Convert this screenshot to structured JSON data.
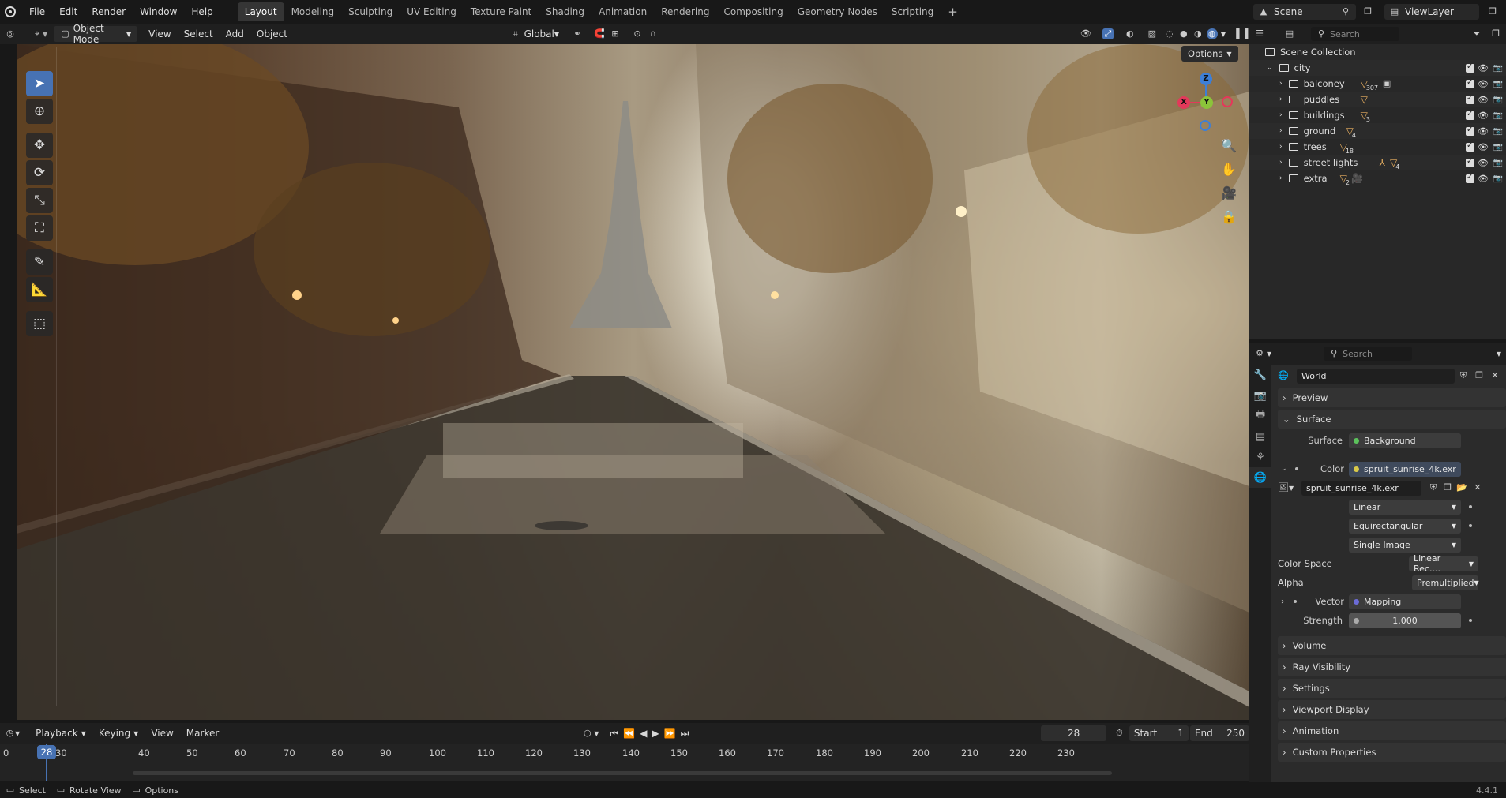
{
  "menubar": {
    "items": [
      "File",
      "Edit",
      "Render",
      "Window",
      "Help"
    ]
  },
  "workspaces": [
    "Layout",
    "Modeling",
    "Sculpting",
    "UV Editing",
    "Texture Paint",
    "Shading",
    "Animation",
    "Rendering",
    "Compositing",
    "Geometry Nodes",
    "Scripting"
  ],
  "active_workspace": "Layout",
  "scene": {
    "label": "Scene"
  },
  "view_layer": {
    "label": "ViewLayer"
  },
  "viewport_header": {
    "mode": "Object Mode",
    "menus": [
      "View",
      "Select",
      "Add",
      "Object"
    ],
    "orientation": "Global",
    "options": "Options"
  },
  "gizmo": {
    "x": "X",
    "y": "Y",
    "z": "Z"
  },
  "outliner": {
    "search_placeholder": "Search",
    "root": "Scene Collection",
    "collection": "city",
    "items": [
      {
        "name": "balconey",
        "count": "307"
      },
      {
        "name": "puddles",
        "count": ""
      },
      {
        "name": "buildings",
        "count": "3"
      },
      {
        "name": "ground",
        "count": "4"
      },
      {
        "name": "trees",
        "count": "18"
      },
      {
        "name": "street lights",
        "count": "4"
      },
      {
        "name": "extra",
        "count": "2"
      }
    ]
  },
  "properties": {
    "search_placeholder": "Search",
    "datablock": "World",
    "panels": {
      "preview": "Preview",
      "surface": "Surface",
      "volume": "Volume",
      "ray_visibility": "Ray Visibility",
      "settings": "Settings",
      "viewport_display": "Viewport Display",
      "animation": "Animation",
      "custom_properties": "Custom Properties"
    },
    "surface_label": "Surface",
    "surface_value": "Background",
    "color_label": "Color",
    "color_value": "spruit_sunrise_4k.exr",
    "image_name": "spruit_sunrise_4k.exr",
    "interpolation": "Linear",
    "projection": "Equirectangular",
    "source": "Single Image",
    "color_space_label": "Color Space",
    "color_space_value": "Linear Rec....",
    "alpha_label": "Alpha",
    "alpha_value": "Premultiplied",
    "vector_label": "Vector",
    "vector_value": "Mapping",
    "strength_label": "Strength",
    "strength_value": "1.000"
  },
  "timeline": {
    "menus": [
      "Playback",
      "Keying",
      "View",
      "Marker"
    ],
    "current_frame": "28",
    "start_label": "Start",
    "start_value": "1",
    "end_label": "End",
    "end_value": "250",
    "ticks": [
      "0",
      "30",
      "40",
      "50",
      "60",
      "70",
      "80",
      "90",
      "100",
      "110",
      "120",
      "130",
      "140",
      "150",
      "160",
      "170",
      "180",
      "190",
      "200",
      "210",
      "220",
      "230"
    ]
  },
  "statusbar": {
    "select": "Select",
    "rotate": "Rotate View",
    "options": "Options",
    "version": "4.4.1"
  },
  "colors": {
    "accent": "#4772b3",
    "x_axis": "#e3395a",
    "y_axis": "#8bc43a",
    "z_axis": "#3d7fd6",
    "playhead": "#4772b3"
  }
}
